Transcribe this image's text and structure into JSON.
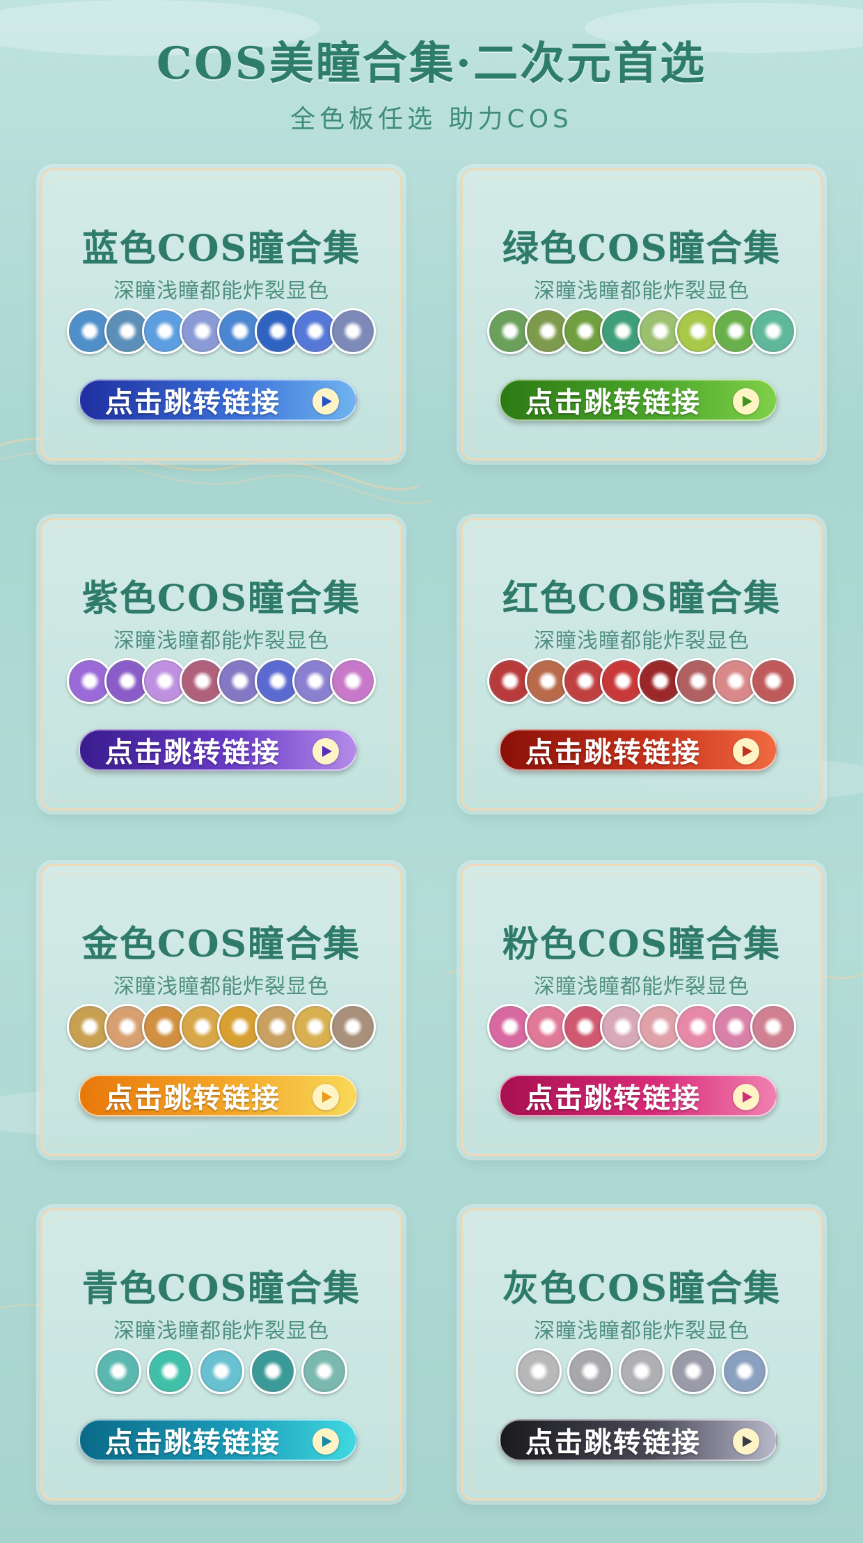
{
  "header": {
    "title": "COS美瞳合集·二次元首选",
    "subtitle": "全色板任选 助力COS"
  },
  "cards": [
    {
      "title": "蓝色COS瞳合集",
      "subtitle": "深瞳浅瞳都能炸裂显色",
      "button_label": "点击跳转链接",
      "button_gradient": [
        "#1f2fa0",
        "#3a6fd8",
        "#6fb3ee"
      ],
      "arrow_color": "#2855c6",
      "lens_colors": [
        "#4f8fc9",
        "#5b8fb8",
        "#5c9ee0",
        "#8a9ad6",
        "#4a86d2",
        "#2f63c2",
        "#5577d8",
        "#7d8ab8"
      ]
    },
    {
      "title": "绿色COS瞳合集",
      "subtitle": "深瞳浅瞳都能炸裂显色",
      "button_label": "点击跳转链接",
      "button_gradient": [
        "#2d7a14",
        "#4aa52a",
        "#7fd048"
      ],
      "arrow_color": "#3e951f",
      "lens_colors": [
        "#6aa05a",
        "#7e9a4c",
        "#6f9f3e",
        "#3f9e7a",
        "#9cc070",
        "#a8c84a",
        "#6ab04a",
        "#5fb89a"
      ]
    },
    {
      "title": "紫色COS瞳合集",
      "subtitle": "深瞳浅瞳都能炸裂显色",
      "button_label": "点击跳转链接",
      "button_gradient": [
        "#3a1c8e",
        "#6a3cc8",
        "#b48ae8"
      ],
      "arrow_color": "#5a2fb8",
      "lens_colors": [
        "#9a6ad8",
        "#8a5cc8",
        "#c090e0",
        "#b0607a",
        "#8478c4",
        "#5a6ad0",
        "#8a80d0",
        "#c878c8"
      ]
    },
    {
      "title": "红色COS瞳合集",
      "subtitle": "深瞳浅瞳都能炸裂显色",
      "button_label": "点击跳转链接",
      "button_gradient": [
        "#8a1008",
        "#c8321c",
        "#f06a40"
      ],
      "arrow_color": "#c0301a",
      "lens_colors": [
        "#b83a3a",
        "#b86a4a",
        "#c04040",
        "#c83838",
        "#9a2828",
        "#b06060",
        "#d88888",
        "#c05a5a"
      ]
    },
    {
      "title": "金色COS瞳合集",
      "subtitle": "深瞳浅瞳都能炸裂显色",
      "button_label": "点击跳转链接",
      "button_gradient": [
        "#e8780a",
        "#f4a82a",
        "#f8d858"
      ],
      "arrow_color": "#e89a18",
      "lens_colors": [
        "#c8a050",
        "#d8a070",
        "#d09040",
        "#d8a848",
        "#d8a030",
        "#c8a060",
        "#d8b050",
        "#a8907a"
      ]
    },
    {
      "title": "粉色COS瞳合集",
      "subtitle": "深瞳浅瞳都能炸裂显色",
      "button_label": "点击跳转链接",
      "button_gradient": [
        "#a81050",
        "#d82a78",
        "#f080b0"
      ],
      "arrow_color": "#d03078",
      "lens_colors": [
        "#d868a0",
        "#e07898",
        "#d05870",
        "#d8a8b8",
        "#e0a0a8",
        "#e888a8",
        "#d880a8",
        "#d08090"
      ]
    },
    {
      "title": "青色COS瞳合集",
      "subtitle": "深瞳浅瞳都能炸裂显色",
      "button_label": "点击跳转链接",
      "button_gradient": [
        "#0a6a88",
        "#1a9ab8",
        "#40d8e0"
      ],
      "arrow_color": "#1a8aa8",
      "lens_colors": [
        "#5ab8b0",
        "#40c0a8",
        "#68c0d0",
        "#3a9a98",
        "#7ab8b0"
      ]
    },
    {
      "title": "灰色COS瞳合集",
      "subtitle": "深瞳浅瞳都能炸裂显色",
      "button_label": "点击跳转链接",
      "button_gradient": [
        "#1a1a1e",
        "#4a4a58",
        "#b8b8cc"
      ],
      "arrow_color": "#3a3a48",
      "lens_colors": [
        "#b8b8b8",
        "#a8a8ac",
        "#b0b0b4",
        "#9a9aa8",
        "#8aa0c0"
      ]
    }
  ]
}
